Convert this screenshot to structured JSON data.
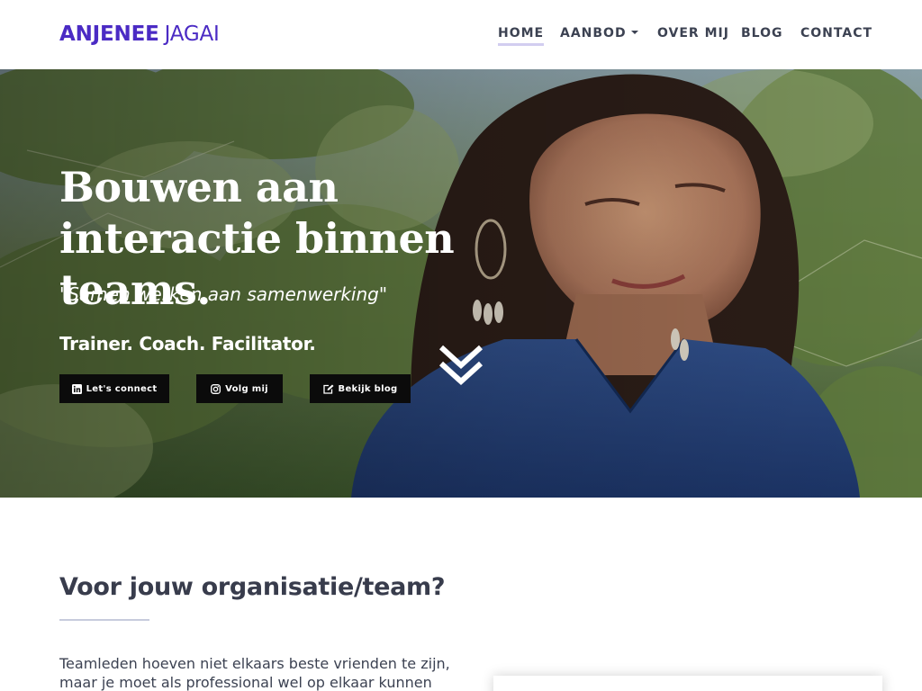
{
  "brand": {
    "name_first": "ANJENEE",
    "name_last": "JAGAI"
  },
  "nav": {
    "home": "HOME",
    "aanbod": "AANBOD",
    "over_mij": "OVER MIJ",
    "blog": "BLOG",
    "contact": "CONTACT"
  },
  "hero": {
    "headline": "Bouwen aan interactie binnen teams.",
    "tagline": "\"Samen werken aan samenwerking\"",
    "roles": "Trainer. Coach. Facilitator.",
    "buttons": {
      "connect": "Let's connect",
      "follow": "Volg mij",
      "blog": "Bekijk blog"
    }
  },
  "section": {
    "title": "Voor jouw organisatie/team?",
    "text": "Teamleden hoeven niet elkaars beste vrienden te zijn, maar je moet als professional wel op elkaar kunnen vertrouwen."
  },
  "colors": {
    "brand": "#4b2bc4",
    "nav_text": "#3c4252",
    "active_underline": "#d2cdf0",
    "button_bg": "#0b0b0b"
  },
  "icons": {
    "connect": "linkedin-icon",
    "follow": "instagram-icon",
    "blog": "edit-icon",
    "scroll": "double-chevron-down-icon",
    "dropdown": "caret-down-icon"
  }
}
